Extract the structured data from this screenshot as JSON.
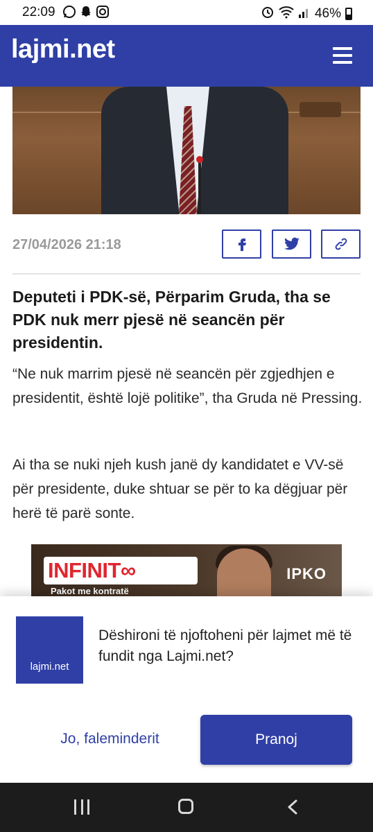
{
  "status_bar": {
    "time": "22:09",
    "battery": "46%",
    "left_icons": [
      "whatsapp-icon",
      "snapchat-icon",
      "instagram-icon"
    ],
    "right_icons": [
      "alarm-icon",
      "wifi-icon",
      "signal-icon",
      "battery-icon"
    ]
  },
  "header": {
    "logo": "lajmi.net",
    "menu_icon": "hamburger-menu-icon",
    "background": "#2f3fa6"
  },
  "article": {
    "date": "27/04/2026 21:18",
    "share_buttons": [
      "facebook-icon",
      "twitter-icon",
      "link-icon"
    ],
    "lead": "Deputeti i PDK-së, Përparim Gruda, tha se PDK nuk merr pjesë në seancën për presidentin.",
    "paragraphs": [
      "“Ne nuk marrim pjesë në seancën për zgjedhjen e presidentit, është lojë politike”, tha Gruda në Pressing.",
      "Ai tha se nuki njeh kush janë dy kandidatet e VV-së për presidente, duke shtuar se për to ka dëgjuar për herë të parë sonte."
    ]
  },
  "ad": {
    "brand": "INFINIT∞",
    "tagline": "Pakot me kontratë",
    "partner": "IPKO"
  },
  "notification_prompt": {
    "logo_text": "lajmi.net",
    "message": "Dëshironi të njoftoheni për lajmet më të fundit nga Lajmi.net?",
    "decline_label": "Jo, faleminderit",
    "accept_label": "Pranoj"
  },
  "nav_bar": {
    "buttons": [
      "recent-apps-icon",
      "home-icon",
      "back-icon"
    ]
  }
}
